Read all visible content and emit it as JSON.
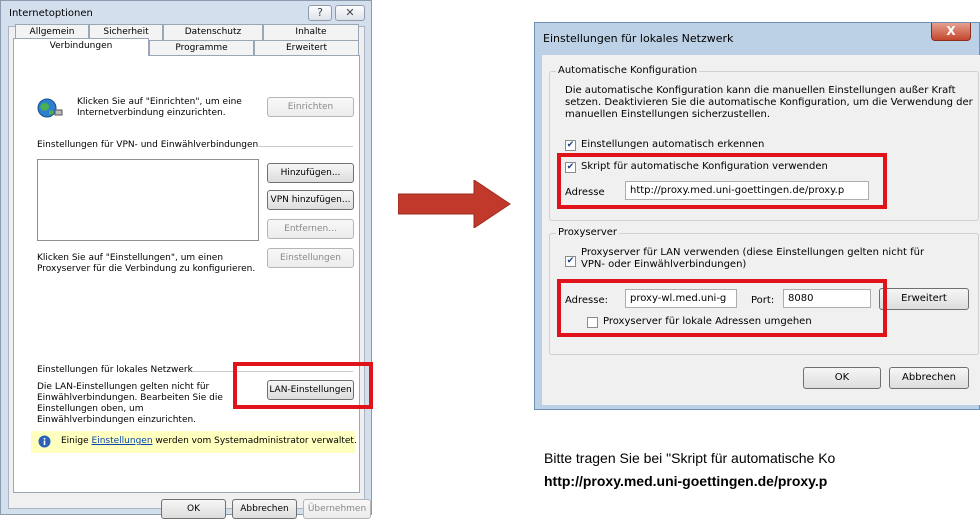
{
  "left_dialog": {
    "title": "Internetoptionen",
    "help_label": "?",
    "close_label": "✕",
    "tabs_row1": [
      "Allgemein",
      "Sicherheit",
      "Datenschutz",
      "Inhalte"
    ],
    "tabs_row2": [
      "Verbindungen",
      "Programme",
      "Erweitert"
    ],
    "setup_text": "Klicken Sie auf \"Einrichten\", um eine Internetverbindung einzurichten.",
    "setup_button": "Einrichten",
    "vpn_group": "Einstellungen für VPN- und Einwählverbindungen",
    "add_button": "Hinzufügen...",
    "add_vpn_button": "VPN hinzufügen...",
    "remove_button": "Entfernen...",
    "settings_text": "Klicken Sie auf \"Einstellungen\", um einen Proxyserver für die Verbindung zu konfigurieren.",
    "settings_button": "Einstellungen",
    "lan_group": "Einstellungen für lokales Netzwerk",
    "lan_text": "Die LAN-Einstellungen gelten nicht für Einwählverbindungen. Bearbeiten Sie die Einstellungen oben, um Einwählverbindungen einzurichten.",
    "lan_button": "LAN-Einstellungen",
    "info_prefix": "Einige",
    "info_link": "Einstellungen",
    "info_suffix": "werden vom Systemadministrator verwaltet.",
    "ok_button": "OK",
    "cancel_button": "Abbrechen",
    "apply_button": "Übernehmen"
  },
  "right_dialog": {
    "title": "Einstellungen für lokales Netzwerk",
    "close_label": "X",
    "auto_group": "Automatische Konfiguration",
    "auto_text": "Die automatische Konfiguration kann die manuellen Einstellungen außer Kraft setzen. Deaktivieren Sie die automatische Konfiguration, um die Verwendung der manuellen Einstellungen sicherzustellen.",
    "auto_detect_label": "Einstellungen automatisch erkennen",
    "auto_detect_checked": true,
    "script_label": "Skript für automatische Konfiguration verwenden",
    "script_checked": true,
    "address_label": "Adresse",
    "address_value": "http://proxy.med.uni-goettingen.de/proxy.p",
    "proxy_group": "Proxyserver",
    "proxy_label": "Proxyserver für LAN verwenden (diese Einstellungen gelten nicht für VPN- oder Einwählverbindungen)",
    "proxy_checked": true,
    "proxy_address_label": "Adresse:",
    "proxy_address_value": "proxy-wl.med.uni-g",
    "port_label": "Port:",
    "port_value": "8080",
    "advanced_button": "Erweitert",
    "bypass_label": "Proxyserver für lokale Adressen umgehen",
    "bypass_checked": false,
    "ok_button": "OK",
    "cancel_button": "Abbrechen"
  },
  "instructions": {
    "line1": "Bitte tragen Sie bei \"Skript für automatische Ko",
    "line2": "http://proxy.med.uni-goettingen.de/proxy.p"
  },
  "colors": {
    "highlight": "#e0121a",
    "arrow": "#c0392b",
    "info_bg": "#ffffc0"
  }
}
